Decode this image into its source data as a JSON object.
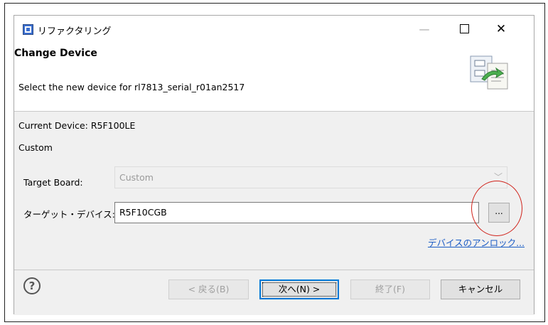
{
  "window": {
    "title": "リファクタリング",
    "min_glyph": "—",
    "close_glyph": "✕"
  },
  "header": {
    "title": "Change Device",
    "description": "Select the new device for rl7813_serial_r01an2517"
  },
  "body": {
    "current_device": "Current Device: R5F100LE",
    "custom": "Custom",
    "target_board_label": "Target Board:",
    "target_board_value": "Custom",
    "target_device_label": "ターゲット・デバイス:",
    "target_device_value": "R5F10CGB",
    "browse_label": "...",
    "device_lock_link": "デバイスのアンロック..."
  },
  "footer": {
    "help_symbol": "?",
    "back_label": "< 戻る(B)",
    "next_label": "次へ(N) >",
    "finish_label": "終了(F)",
    "cancel_label": "キャンセル"
  },
  "colors": {
    "annotation_circle": "#d0231b",
    "link": "#1a5cc5",
    "panel_bg": "#f0f0f0"
  }
}
